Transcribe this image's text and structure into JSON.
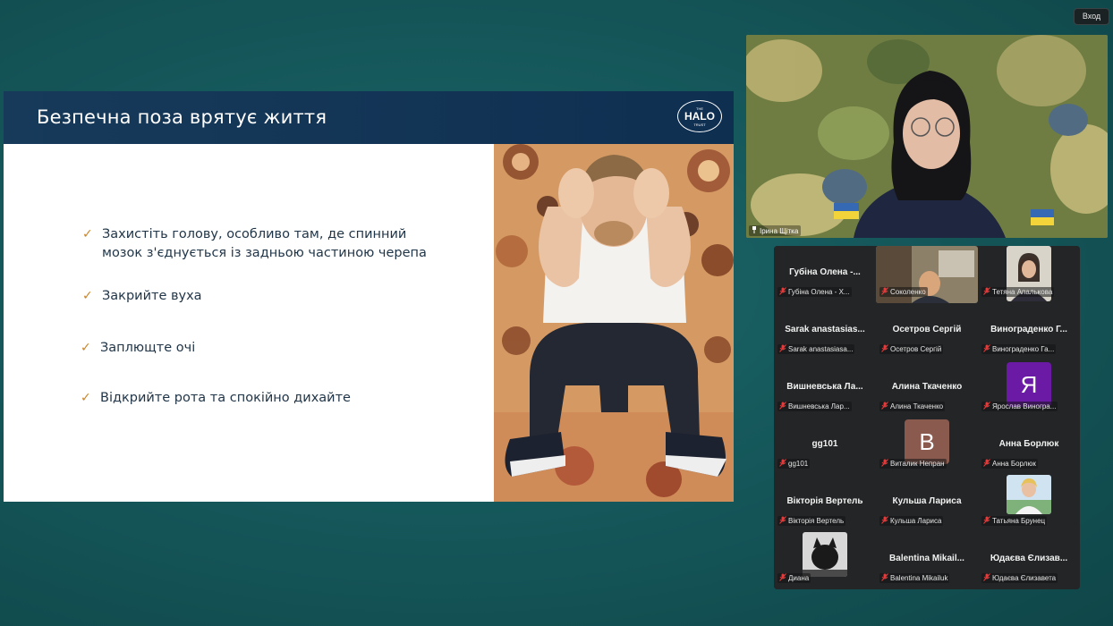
{
  "top_bar": {
    "login_label": "Вход"
  },
  "slide": {
    "title": "Безпечна поза врятує життя",
    "logo": {
      "top": "THE",
      "main": "HALO",
      "bottom": "TRUST"
    },
    "bullets": [
      "Захистіть голову, особливо там, де спинний\nмозок з'єднується із задньою частиною черепа",
      "Закрийте вуха",
      "Заплющте очі",
      "Відкрийте рота та спокійно дихайте"
    ]
  },
  "speaker": {
    "name": "Ірина Щітка"
  },
  "gallery": {
    "participants": [
      {
        "display": "Губіна Олена -...",
        "label": "Губіна Олена - Х...",
        "kind": "name"
      },
      {
        "display": "",
        "label": "Соколенко",
        "kind": "video"
      },
      {
        "display": "",
        "label": "Тетяна Апалькова",
        "kind": "photo"
      },
      {
        "display": "Sarak anastasias...",
        "label": "Sarak anastasiasa...",
        "kind": "name"
      },
      {
        "display": "Осетров Сергій",
        "label": "Осетров Сергій",
        "kind": "name"
      },
      {
        "display": "Винограденко Г...",
        "label": "Винограденко Га...",
        "kind": "name"
      },
      {
        "display": "Вишневська Ла...",
        "label": "Вишневська Лар...",
        "kind": "name"
      },
      {
        "display": "Алина Ткаченко",
        "label": "Алина Ткаченко",
        "kind": "name"
      },
      {
        "display": "Я",
        "label": "Ярослав Виногра...",
        "kind": "letter",
        "color": "#6b1aa6"
      },
      {
        "display": "gg101",
        "label": "gg101",
        "kind": "name"
      },
      {
        "display": "В",
        "label": "Виталик Непран",
        "kind": "letter",
        "color": "#8a5a4e"
      },
      {
        "display": "Анна Борлюк",
        "label": "Анна Борлюк",
        "kind": "name"
      },
      {
        "display": "Вікторія Вертель",
        "label": "Вікторія Вертель",
        "kind": "name"
      },
      {
        "display": "Кульша Лариса",
        "label": "Кульша Лариса",
        "kind": "name"
      },
      {
        "display": "",
        "label": "Татьяна Брунец",
        "kind": "photo2"
      },
      {
        "display": "",
        "label": "Диана",
        "kind": "cat"
      },
      {
        "display": "Balentina Mikail...",
        "label": "Balentina Mikailuk",
        "kind": "name"
      },
      {
        "display": "Юдаєва Єлизав...",
        "label": "Юдаєва Єлизавета",
        "kind": "name"
      }
    ]
  },
  "colors": {
    "slide_header": "#173a5a",
    "check": "#c8862b",
    "gallery_bg": "#232526",
    "background": "#165a5d"
  }
}
